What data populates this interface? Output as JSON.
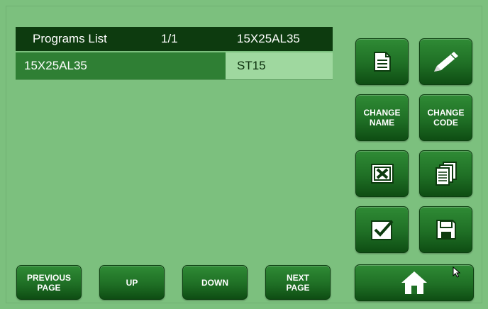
{
  "list": {
    "header": {
      "title": "Programs List",
      "page": "1/1",
      "code": "15X25AL35"
    },
    "rows": [
      {
        "name": "15X25AL35",
        "code": "ST15"
      }
    ]
  },
  "buttons": {
    "new_icon": "document-icon",
    "edit_icon": "pencil-icon",
    "change_name": "CHANGE\nNAME",
    "change_code": "CHANGE\nCODE",
    "delete_icon": "delete-x-icon",
    "copy_icon": "copy-documents-icon",
    "confirm_icon": "checkmark-icon",
    "save_icon": "floppy-disk-icon",
    "previous_page": "PREVIOUS\nPAGE",
    "up": "UP",
    "down": "DOWN",
    "next_page": "NEXT\nPAGE",
    "home_icon": "home-icon"
  },
  "colors": {
    "background": "#7cc07e",
    "header": "#0d3b0f",
    "selected_row": "#2f7f34",
    "code_cell": "#9fd89f",
    "button": "#1f6f25"
  }
}
